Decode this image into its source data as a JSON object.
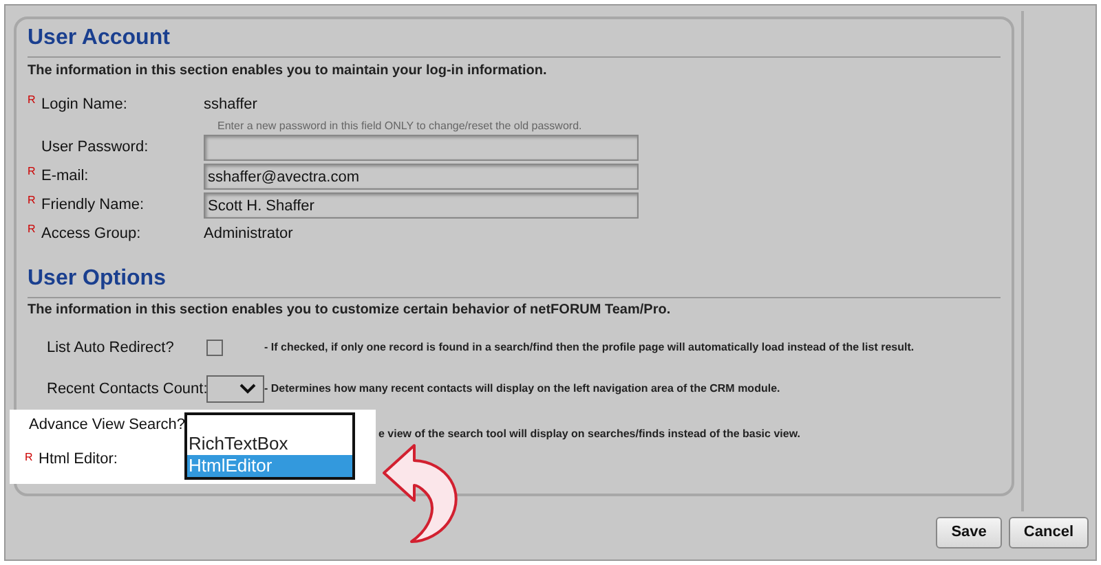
{
  "user_account": {
    "title": "User Account",
    "description": "The information in this section enables you to maintain your log-in information.",
    "fields": [
      {
        "kind": "text",
        "required_mark": "R",
        "label": "Login Name:",
        "value": "sshaffer"
      },
      {
        "kind": "input",
        "label": "User Password:",
        "hint": "Enter a new password in this field ONLY to change/reset the old password."
      },
      {
        "kind": "input",
        "required_mark": "R",
        "label": "E-mail:",
        "value": "sshaffer@avectra.com"
      },
      {
        "kind": "input",
        "required_mark": "R",
        "label": "Friendly Name:",
        "value": "Scott H. Shaffer"
      },
      {
        "kind": "text",
        "required_mark": "R",
        "label": "Access Group:",
        "value": "Administrator"
      }
    ]
  },
  "user_options": {
    "title": "User Options",
    "description": "The information in this section enables you to customize certain behavior of netFORUM Team/Pro.",
    "options": [
      {
        "kind": "checkbox",
        "label": "List Auto Redirect?",
        "checked": false,
        "note": "- If checked, if only one record is found in a search/find then the profile page will automatically load instead of the list result."
      },
      {
        "kind": "select",
        "label": "Recent Contacts Count:",
        "note": "- Determines how many recent contacts will display on the left navigation area of the CRM module."
      }
    ],
    "open_list": {
      "label": "Advance View Search?",
      "note": "e view of the search tool will display on searches/finds instead of the basic view.",
      "second_label": "Html Editor:",
      "second_required_mark": "R",
      "items": [
        {
          "label": "RichTextBox",
          "selected": false
        },
        {
          "label": "HtmlEditor",
          "selected": true
        }
      ]
    }
  },
  "buttons": [
    {
      "label": "Save"
    },
    {
      "label": "Cancel"
    }
  ]
}
